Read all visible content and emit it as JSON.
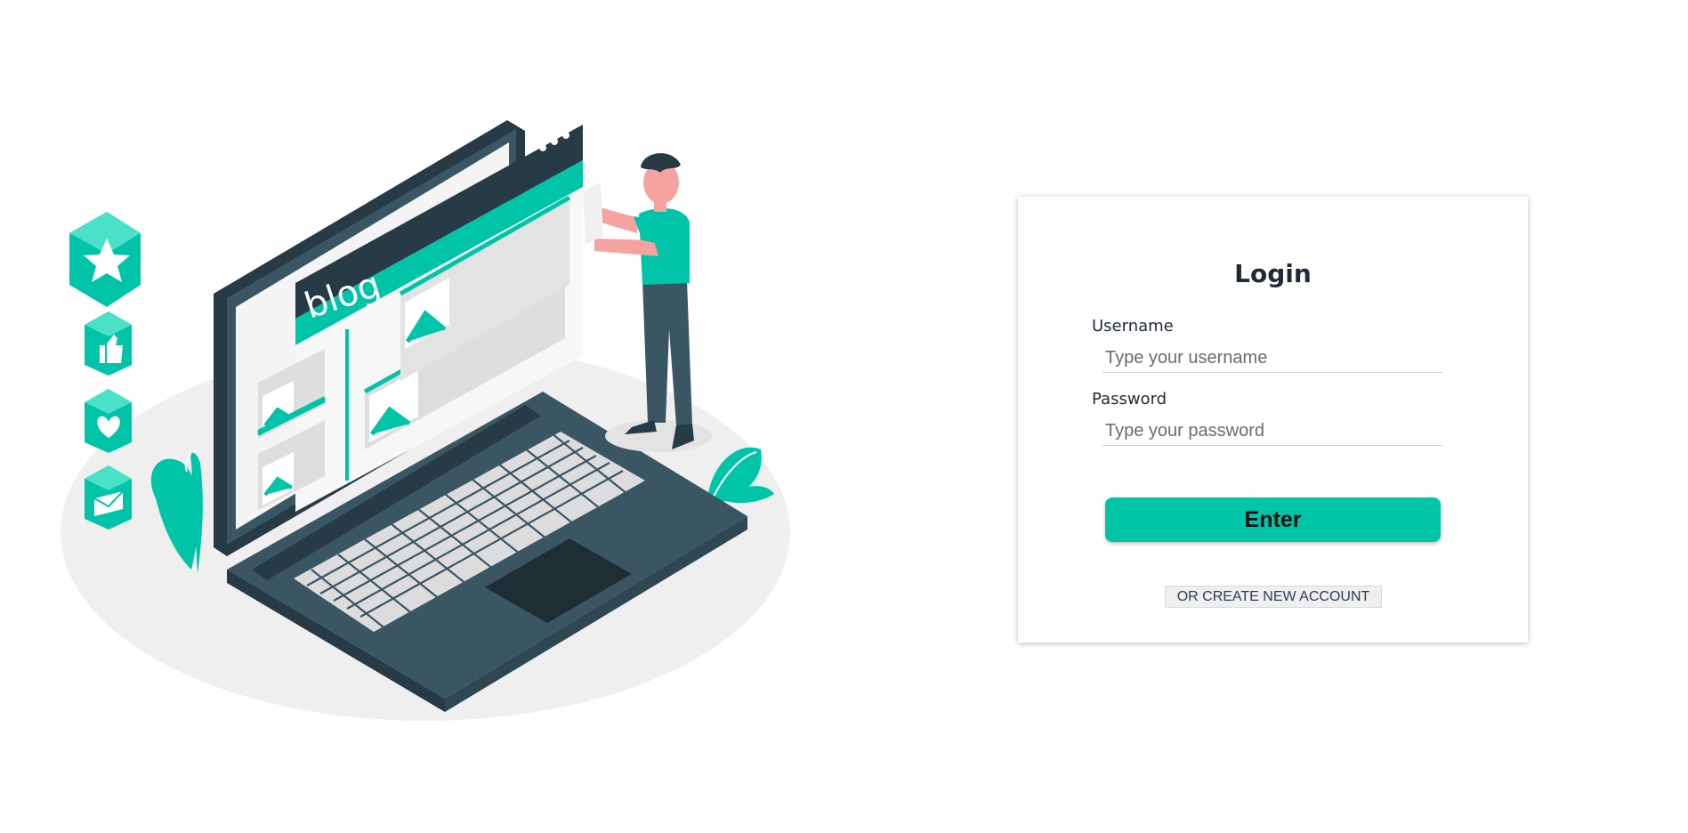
{
  "illustration": {
    "screen_text": "blog"
  },
  "login": {
    "title": "Login",
    "username_label": "Username",
    "username_placeholder": "Type your username",
    "username_value": "",
    "password_label": "Password",
    "password_placeholder": "Type your password",
    "password_value": "",
    "enter_label": "Enter",
    "create_account_label": "OR CREATE NEW ACCOUNT"
  },
  "colors": {
    "accent": "#00c4a8",
    "dark": "#37474f",
    "text": "#1f2a38"
  }
}
